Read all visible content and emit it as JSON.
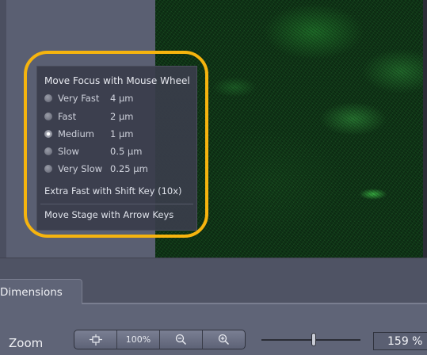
{
  "focus_popup": {
    "title": "Move Focus with Mouse Wheel",
    "speeds": [
      {
        "label": "Very Fast",
        "value": "4 µm",
        "selected": false
      },
      {
        "label": "Fast",
        "value": "2 µm",
        "selected": false
      },
      {
        "label": "Medium",
        "value": "1 µm",
        "selected": true
      },
      {
        "label": "Slow",
        "value": "0.5 µm",
        "selected": false
      },
      {
        "label": "Very Slow",
        "value": "0.25 µm",
        "selected": false
      }
    ],
    "extra_fast_text": "Extra Fast with Shift Key (10x)",
    "stage_text": "Move Stage with Arrow Keys"
  },
  "tabs": {
    "dimensions_label": "Dimensions"
  },
  "zoom": {
    "label": "Zoom",
    "buttons": [
      {
        "name": "fit-to-window",
        "icon": "fit-icon",
        "text": ""
      },
      {
        "name": "zoom-100",
        "icon": "",
        "text": "100%"
      },
      {
        "name": "zoom-out",
        "icon": "zoom-out-icon",
        "text": ""
      },
      {
        "name": "zoom-in",
        "icon": "zoom-in-icon",
        "text": ""
      }
    ],
    "value": "159 %",
    "slider_level": 0.53
  },
  "colors": {
    "highlight": "#f6b40e",
    "fluorescence": "#2a8c3a"
  }
}
